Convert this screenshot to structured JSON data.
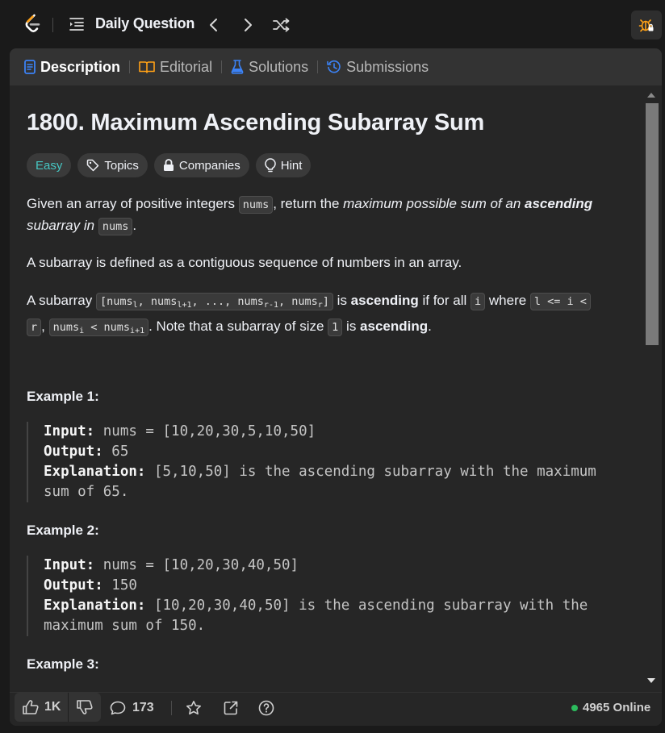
{
  "header": {
    "title": "Daily Question"
  },
  "tabs": [
    {
      "label": "Description"
    },
    {
      "label": "Editorial"
    },
    {
      "label": "Solutions"
    },
    {
      "label": "Submissions"
    }
  ],
  "problem": {
    "title": "1800. Maximum Ascending Subarray Sum",
    "difficulty": "Easy",
    "chips": [
      "Topics",
      "Companies",
      "Hint"
    ]
  },
  "description": {
    "p1_a": "Given an array of positive integers ",
    "p1_code": "nums",
    "p1_b": ", return the ",
    "p1_em": "maximum possible sum of an ",
    "p1_strong": "ascending",
    "p1_em2": "subarray in ",
    "p1_code2": "nums",
    "p1_end": ".",
    "p2": "A subarray is defined as a contiguous sequence of numbers in an array.",
    "p3_a": "A subarray ",
    "p3_b": " is ",
    "p3_strong": "ascending",
    "p3_c": " if for all ",
    "p3_code_i": "i",
    "p3_d": " where ",
    "p3_code_cond1": "l <= i <",
    "p3_code_cond2": "r",
    "p3_e": ", ",
    "p3_f": ". Note that a subarray of size ",
    "p3_code_1": "1",
    "p3_g": " is ",
    "p3_strong2": "ascending",
    "p3_end": "."
  },
  "examples": [
    {
      "heading": "Example 1:",
      "input_label": "Input:",
      "input": " nums = [10,20,30,5,10,50]",
      "output_label": "Output:",
      "output": " 65",
      "explanation_label": "Explanation:",
      "explanation_1": " [5,10,50] is the ascending subarray with the maximum",
      "explanation_2": "sum of 65."
    },
    {
      "heading": "Example 2:",
      "input_label": "Input:",
      "input": " nums = [10,20,30,40,50]",
      "output_label": "Output:",
      "output": " 150",
      "explanation_label": "Explanation:",
      "explanation_1": " [10,20,30,40,50] is the ascending subarray with the",
      "explanation_2": "maximum sum of 150."
    },
    {
      "heading": "Example 3:"
    }
  ],
  "footer": {
    "likes": "1K",
    "comments": "173",
    "online": "4965 Online"
  },
  "colors": {
    "easy": "#46c6c2",
    "online_dot": "#2cbb5d",
    "accent_blue": "#3b82f6"
  }
}
